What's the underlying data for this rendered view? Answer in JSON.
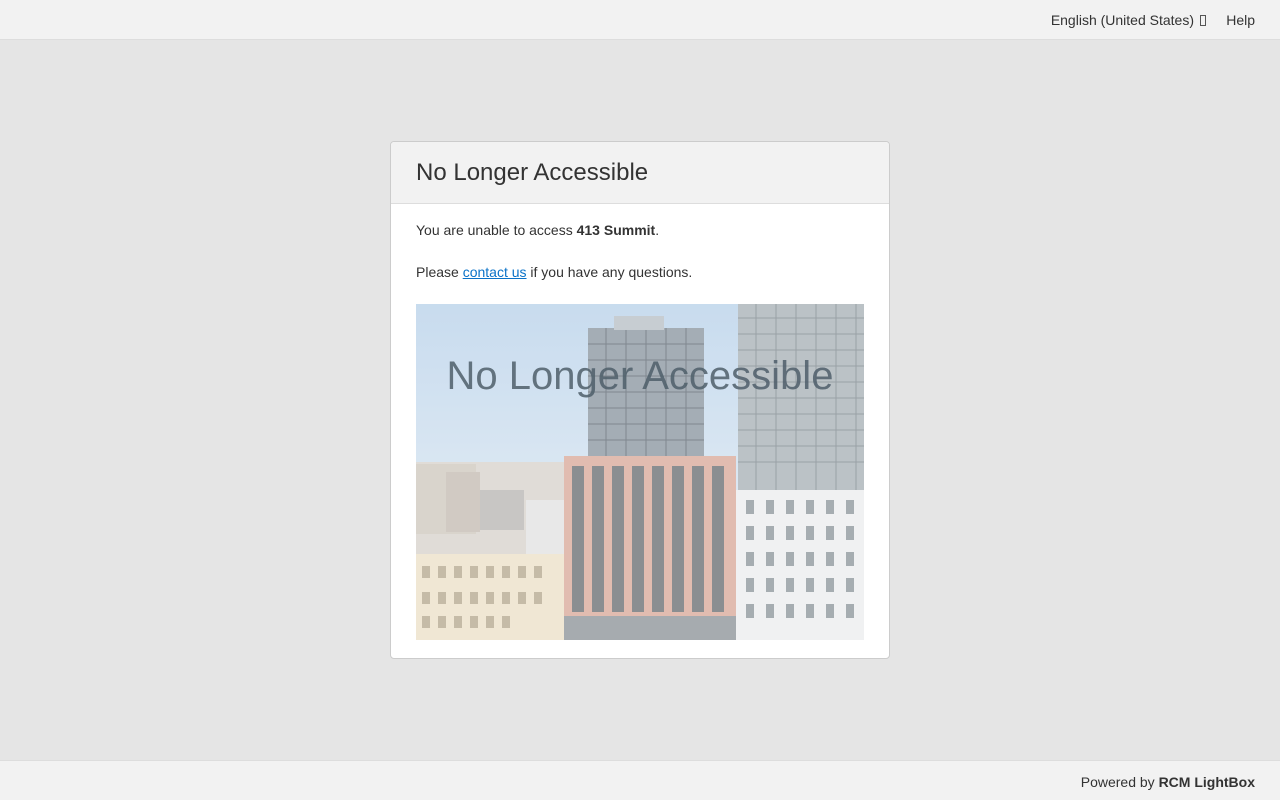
{
  "topbar": {
    "language": "English (United States)",
    "help": "Help"
  },
  "card": {
    "title": "No Longer Accessible",
    "message_prefix": "You are unable to access ",
    "project_name": "413 Summit",
    "message_suffix": ".",
    "contact_prefix": "Please ",
    "contact_link": "contact us",
    "contact_suffix": " if you have any questions.",
    "image_overlay": "No Longer Accessible"
  },
  "footer": {
    "powered_prefix": "Powered by ",
    "brand": "RCM LightBox"
  }
}
